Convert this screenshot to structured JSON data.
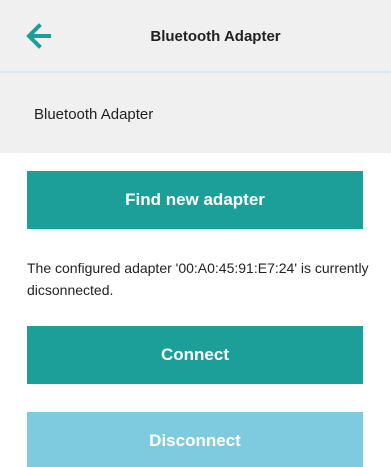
{
  "header": {
    "title": "Bluetooth Adapter",
    "back_icon": "arrow-left-icon",
    "accent_color": "#1c9f98"
  },
  "section": {
    "label": "Bluetooth Adapter"
  },
  "buttons": {
    "find_label": "Find new adapter",
    "connect_label": "Connect",
    "disconnect_label": "Disconnect",
    "primary_color": "#1c9f98",
    "disabled_color": "#7ecbe0"
  },
  "status": {
    "message": "The configured adapter '00:A0:45:91:E7:24' is currently dicsonnected."
  }
}
